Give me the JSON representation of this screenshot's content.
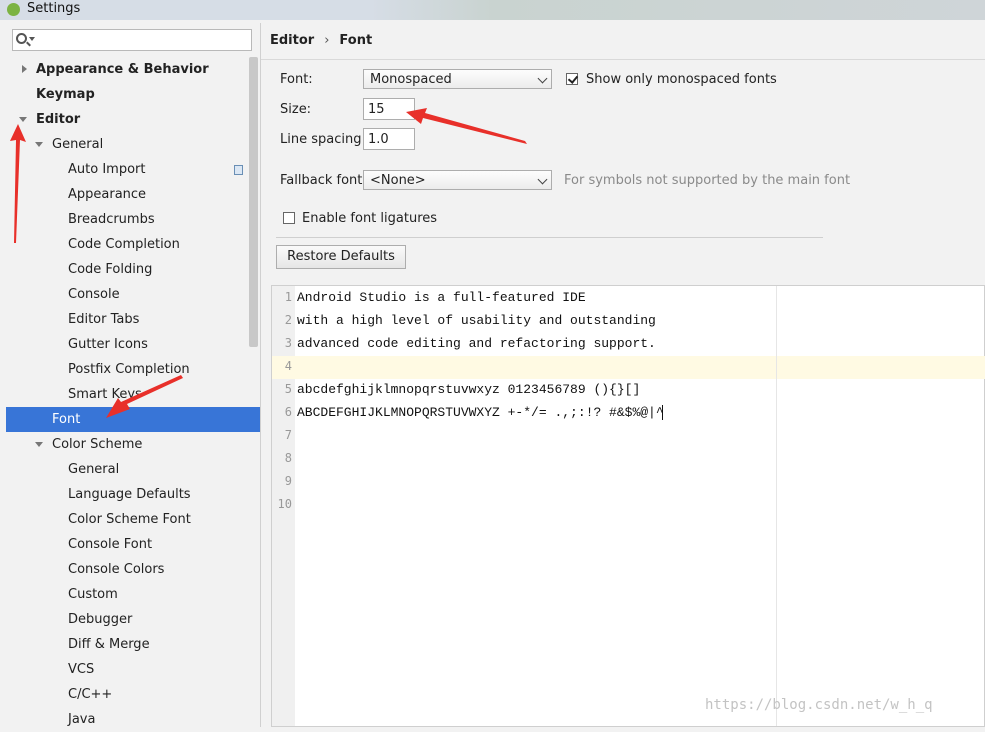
{
  "window": {
    "title": "Settings"
  },
  "search": {
    "placeholder": ""
  },
  "tree": [
    {
      "label": "Appearance & Behavior",
      "level": 0,
      "bold": true,
      "arrow": "right"
    },
    {
      "label": "Keymap",
      "level": 0,
      "bold": true,
      "arrow": "none"
    },
    {
      "label": "Editor",
      "level": 0,
      "bold": true,
      "arrow": "down"
    },
    {
      "label": "General",
      "level": 1,
      "bold": false,
      "arrow": "down"
    },
    {
      "label": "Auto Import",
      "level": 2,
      "bold": false,
      "arrow": "none",
      "icon": "copy-icon"
    },
    {
      "label": "Appearance",
      "level": 2,
      "bold": false,
      "arrow": "none"
    },
    {
      "label": "Breadcrumbs",
      "level": 2,
      "bold": false,
      "arrow": "none"
    },
    {
      "label": "Code Completion",
      "level": 2,
      "bold": false,
      "arrow": "none"
    },
    {
      "label": "Code Folding",
      "level": 2,
      "bold": false,
      "arrow": "none"
    },
    {
      "label": "Console",
      "level": 2,
      "bold": false,
      "arrow": "none"
    },
    {
      "label": "Editor Tabs",
      "level": 2,
      "bold": false,
      "arrow": "none"
    },
    {
      "label": "Gutter Icons",
      "level": 2,
      "bold": false,
      "arrow": "none"
    },
    {
      "label": "Postfix Completion",
      "level": 2,
      "bold": false,
      "arrow": "none"
    },
    {
      "label": "Smart Keys",
      "level": 2,
      "bold": false,
      "arrow": "none"
    },
    {
      "label": "Font",
      "level": 1,
      "bold": false,
      "arrow": "none",
      "selected": true
    },
    {
      "label": "Color Scheme",
      "level": 1,
      "bold": false,
      "arrow": "down"
    },
    {
      "label": "General",
      "level": 2,
      "bold": false,
      "arrow": "none"
    },
    {
      "label": "Language Defaults",
      "level": 2,
      "bold": false,
      "arrow": "none"
    },
    {
      "label": "Color Scheme Font",
      "level": 2,
      "bold": false,
      "arrow": "none"
    },
    {
      "label": "Console Font",
      "level": 2,
      "bold": false,
      "arrow": "none"
    },
    {
      "label": "Console Colors",
      "level": 2,
      "bold": false,
      "arrow": "none"
    },
    {
      "label": "Custom",
      "level": 2,
      "bold": false,
      "arrow": "none"
    },
    {
      "label": "Debugger",
      "level": 2,
      "bold": false,
      "arrow": "none"
    },
    {
      "label": "Diff & Merge",
      "level": 2,
      "bold": false,
      "arrow": "none"
    },
    {
      "label": "VCS",
      "level": 2,
      "bold": false,
      "arrow": "none"
    },
    {
      "label": "C/C++",
      "level": 2,
      "bold": false,
      "arrow": "none"
    },
    {
      "label": "Java",
      "level": 2,
      "bold": false,
      "arrow": "none"
    }
  ],
  "breadcrumb": {
    "parent": "Editor",
    "separator": "›",
    "current": "Font"
  },
  "form": {
    "font_label": "Font:",
    "font_value": "Monospaced",
    "monospaced_only_label": "Show only monospaced fonts",
    "monospaced_only_checked": true,
    "size_label": "Size:",
    "size_value": "15",
    "line_spacing_label": "Line spacing:",
    "line_spacing_value": "1.0",
    "fallback_label": "Fallback font:",
    "fallback_value": "<None>",
    "fallback_hint": "For symbols not supported by the main font",
    "ligatures_label": "Enable font ligatures",
    "ligatures_checked": false,
    "restore_label": "Restore Defaults"
  },
  "preview": {
    "line_numbers": [
      "1",
      "2",
      "3",
      "4",
      "5",
      "6",
      "7",
      "8",
      "9",
      "10"
    ],
    "lines": [
      "Android Studio is a full-featured IDE",
      "with a high level of usability and outstanding",
      "advanced code editing and refactoring support.",
      "",
      "abcdefghijklmnopqrstuvwxyz 0123456789 (){}[]",
      "ABCDEFGHIJKLMNOPQRSTUVWXYZ +-*/= .,;:!? #&$%@|^",
      "",
      "",
      "",
      ""
    ]
  },
  "watermark": "https://blog.csdn.net/w_h_q",
  "colors": {
    "selection": "#3875d7",
    "annotation_arrow": "#e8302a",
    "caret_line": "#fffae3"
  }
}
